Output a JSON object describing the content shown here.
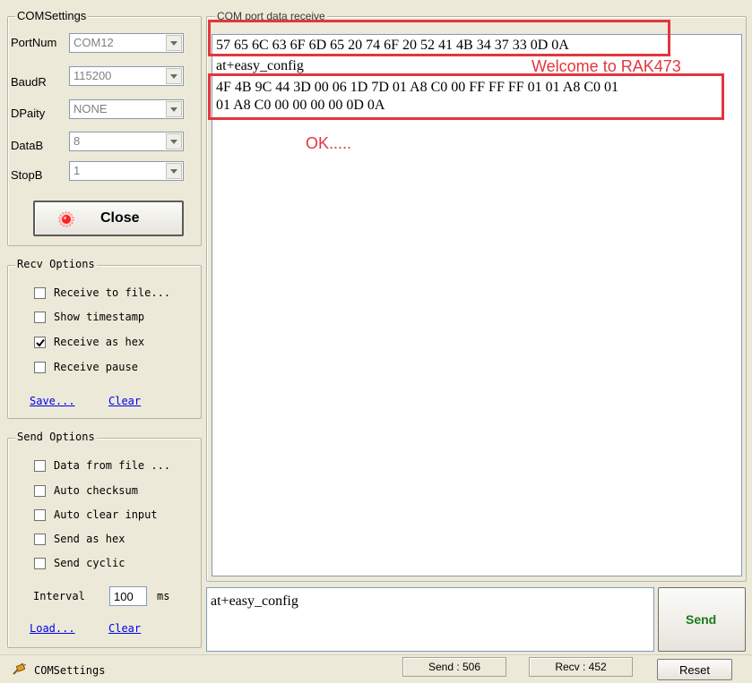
{
  "com_settings": {
    "legend": "COMSettings",
    "fields": [
      {
        "label": "PortNum",
        "value": "COM12"
      },
      {
        "label": "BaudR",
        "value": "115200"
      },
      {
        "label": "DPaity",
        "value": "NONE"
      },
      {
        "label": "DataB",
        "value": "8"
      },
      {
        "label": "StopB",
        "value": "1"
      }
    ],
    "close_label": "Close"
  },
  "recv_options": {
    "legend": "Recv Options",
    "items": [
      {
        "label": "Receive to file...",
        "checked": false
      },
      {
        "label": "Show timestamp",
        "checked": false
      },
      {
        "label": "Receive as hex",
        "checked": true
      },
      {
        "label": "Receive pause",
        "checked": false
      }
    ],
    "save_link": "Save...",
    "clear_link": "Clear"
  },
  "send_options": {
    "legend": "Send Options",
    "items": [
      {
        "label": "Data from file ...",
        "checked": false
      },
      {
        "label": "Auto checksum",
        "checked": false
      },
      {
        "label": "Auto clear input",
        "checked": false
      },
      {
        "label": "Send as hex",
        "checked": false
      },
      {
        "label": "Send cyclic",
        "checked": false
      }
    ],
    "interval_label": "Interval",
    "interval_value": "100",
    "interval_unit": "ms",
    "load_link": "Load...",
    "clear_link": "Clear"
  },
  "receive_panel": {
    "legend": "COM port data receive",
    "lines": [
      "57 65 6C 63 6F 6D 65 20 74 6F 20 52 41 4B 34 37 33 0D 0A",
      "at+easy_config",
      "4F 4B 9C 44 3D 00 06 1D 7D 01 A8 C0 00 FF FF FF 01 01 A8 C0 01",
      "01 A8 C0 00 00 00 00 0D 0A"
    ],
    "annotation_welcome": "Welcome to RAK473",
    "annotation_ok": "OK....."
  },
  "send_panel": {
    "input_value": "at+easy_config",
    "send_label": "Send"
  },
  "status_bar": {
    "label": "COMSettings",
    "send_count": "Send : 506",
    "recv_count": "Recv : 452",
    "reset_label": "Reset"
  },
  "colors": {
    "annotation_red": "#e2363d",
    "link_blue": "#0000ee",
    "send_green": "#1a7a1a",
    "window_bg": "#ece9d8"
  },
  "icons": {
    "close_button_icon": "red-led-icon",
    "status_icon": "serial-plug-icon",
    "checkbox_checked": "checkmark-icon",
    "dropdown": "chevron-down-icon"
  }
}
